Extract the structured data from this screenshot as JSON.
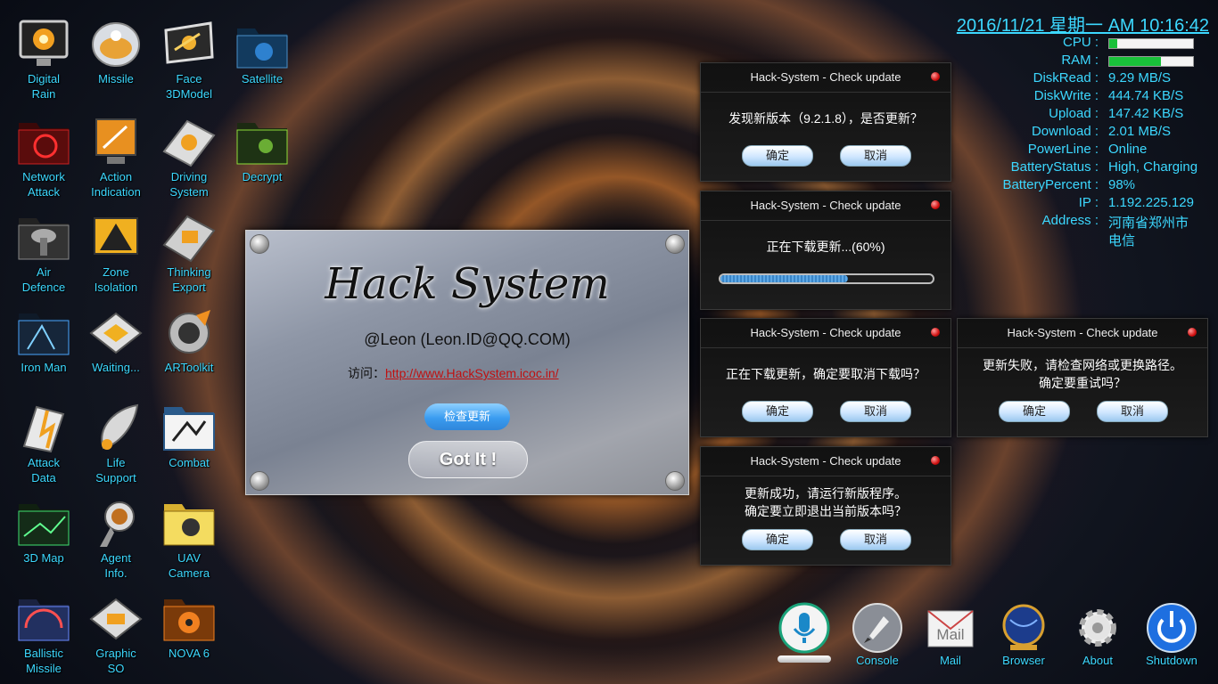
{
  "desktop_icons": [
    {
      "label": "Digital\nRain",
      "icon": "digital-rain-icon"
    },
    {
      "label": "Missile",
      "icon": "missile-icon"
    },
    {
      "label": "Face\n3DModel",
      "icon": "face-3dmodel-icon"
    },
    {
      "label": "Satellite",
      "icon": "satellite-folder-icon"
    },
    {
      "label": "Network\nAttack",
      "icon": "network-attack-folder-icon"
    },
    {
      "label": "Action\nIndication",
      "icon": "action-indication-icon"
    },
    {
      "label": "Driving\nSystem",
      "icon": "driving-system-icon"
    },
    {
      "label": "Decrypt",
      "icon": "decrypt-folder-icon"
    },
    {
      "label": "Air\nDefence",
      "icon": "air-defence-folder-icon"
    },
    {
      "label": "Zone\nIsolation",
      "icon": "zone-isolation-icon"
    },
    {
      "label": "Thinking\nExport",
      "icon": "thinking-export-icon"
    },
    {
      "label": "Iron Man",
      "icon": "iron-man-folder-icon"
    },
    {
      "label": "Waiting...",
      "icon": "waiting-icon"
    },
    {
      "label": "ARToolkit",
      "icon": "artoolkit-icon"
    },
    {
      "label": "Attack\nData",
      "icon": "attack-data-icon"
    },
    {
      "label": "Life\nSupport",
      "icon": "life-support-icon"
    },
    {
      "label": "Combat",
      "icon": "combat-folder-icon"
    },
    {
      "label": "3D Map",
      "icon": "3d-map-folder-icon"
    },
    {
      "label": "Agent\nInfo.",
      "icon": "agent-info-icon"
    },
    {
      "label": "UAV\nCamera",
      "icon": "uav-camera-folder-icon"
    },
    {
      "label": "Ballistic\nMissile",
      "icon": "ballistic-missile-folder-icon"
    },
    {
      "label": "Graphic\nSO",
      "icon": "graphic-so-icon"
    },
    {
      "label": "NOVA 6",
      "icon": "nova6-folder-icon"
    }
  ],
  "status": {
    "clock": "2016/11/21 星期一 AM 10:16:42",
    "cpu_label": "CPU :",
    "cpu_fraction": 0.1,
    "ram_label": "RAM :",
    "ram_fraction": 0.62,
    "rows": [
      {
        "label": "DiskRead :",
        "value": "9.29 MB/S"
      },
      {
        "label": "DiskWrite :",
        "value": "444.74 KB/S"
      },
      {
        "label": "Upload :",
        "value": "147.42 KB/S"
      },
      {
        "label": "Download :",
        "value": "2.01 MB/S"
      },
      {
        "label": "PowerLine :",
        "value": "Online"
      },
      {
        "label": "BatteryStatus :",
        "value": "High, Charging"
      },
      {
        "label": "BatteryPercent :",
        "value": "98%"
      },
      {
        "label": "IP :",
        "value": "1.192.225.129"
      },
      {
        "label": "Address :",
        "value": "河南省郑州市"
      }
    ],
    "address_line2": "电信"
  },
  "dialogs": {
    "title": "Hack-System - Check update",
    "ok": "确定",
    "cancel": "取消",
    "new_version": "发现新版本（9.2.1.8），是否更新？",
    "downloading": "正在下载更新...(60%)",
    "download_progress": 0.6,
    "cancel_download": "正在下载更新，确定要取消下载吗？",
    "failed_line1": "更新失败，请检查网络或更换路径。",
    "failed_line2": "确定要重试吗？",
    "success_line1": "更新成功，请运行新版程序。",
    "success_line2": "确定要立即退出当前版本吗？"
  },
  "about": {
    "brand": "Hack System",
    "author": "@Leon (Leon.ID@QQ.COM)",
    "visit_label": "访问：",
    "url": "http://www.HackSystem.icoc.in/",
    "check_button": "检查更新",
    "got_it_button": "Got It !"
  },
  "dock": [
    {
      "label": "",
      "icon": "microphone-icon"
    },
    {
      "label": "Console",
      "icon": "rocket-icon"
    },
    {
      "label": "Mail",
      "icon": "mail-icon"
    },
    {
      "label": "Browser",
      "icon": "globe-icon"
    },
    {
      "label": "About",
      "icon": "gear-icon"
    },
    {
      "label": "Shutdown",
      "icon": "power-icon"
    }
  ],
  "dock_mail_text": "Mail",
  "colors": {
    "accent": "#3cd8ff",
    "meter": "#19c13a",
    "link": "#c01010"
  }
}
